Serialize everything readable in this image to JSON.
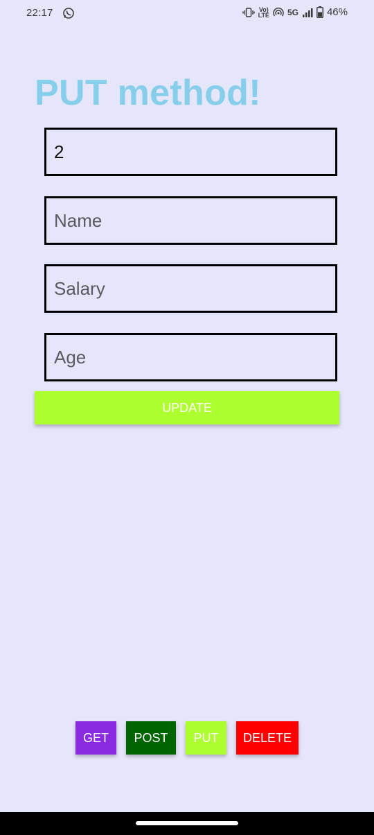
{
  "status_bar": {
    "time": "22:17",
    "net_top": "Vo)",
    "net_bottom": "LTE",
    "network": "5G",
    "battery": "46%"
  },
  "title": "PUT method!",
  "form": {
    "id_value": "2",
    "name_placeholder": "Name",
    "salary_placeholder": "Salary",
    "age_placeholder": "Age",
    "update_label": "UPDATE"
  },
  "nav": {
    "get": "GET",
    "post": "POST",
    "put": "PUT",
    "delete": "DELETE"
  },
  "colors": {
    "background": "#e6e6fa",
    "title": "#87ceeb",
    "update": "#adff2f",
    "get": "#8a2be2",
    "post": "#006400",
    "put": "#adff2f",
    "delete": "#ff0000"
  },
  "icons": [
    "whatsapp-icon",
    "vibrate-icon",
    "hotspot-icon",
    "signal-icon",
    "battery-icon"
  ]
}
